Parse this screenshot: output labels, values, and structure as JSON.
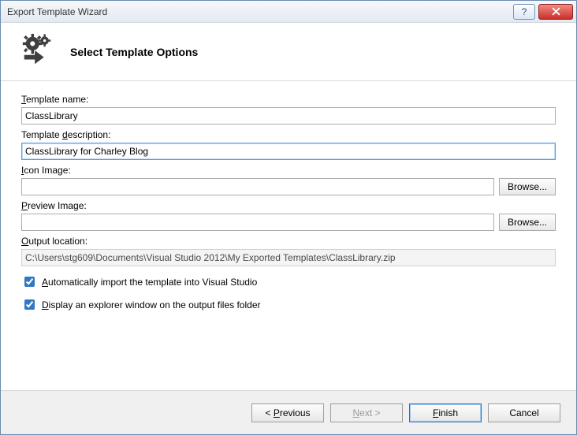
{
  "window": {
    "title": "Export Template Wizard"
  },
  "header": {
    "title": "Select Template Options"
  },
  "labels": {
    "template_name": "Template name:",
    "template_description": "Template description:",
    "icon_image": "Icon Image:",
    "preview_image": "Preview Image:",
    "output_location": "Output location:",
    "browse": "Browse...",
    "auto_import": "Automatically import the template into Visual Studio",
    "display_explorer": "Display an explorer window on the output files folder"
  },
  "values": {
    "template_name": "ClassLibrary",
    "template_description": "ClassLibrary for Charley Blog",
    "icon_image": "",
    "preview_image": "",
    "output_location": "C:\\Users\\stg609\\Documents\\Visual Studio 2012\\My Exported Templates\\ClassLibrary.zip",
    "auto_import_checked": true,
    "display_explorer_checked": true
  },
  "buttons": {
    "previous": "< Previous",
    "next": "Next >",
    "finish": "Finish",
    "cancel": "Cancel"
  }
}
